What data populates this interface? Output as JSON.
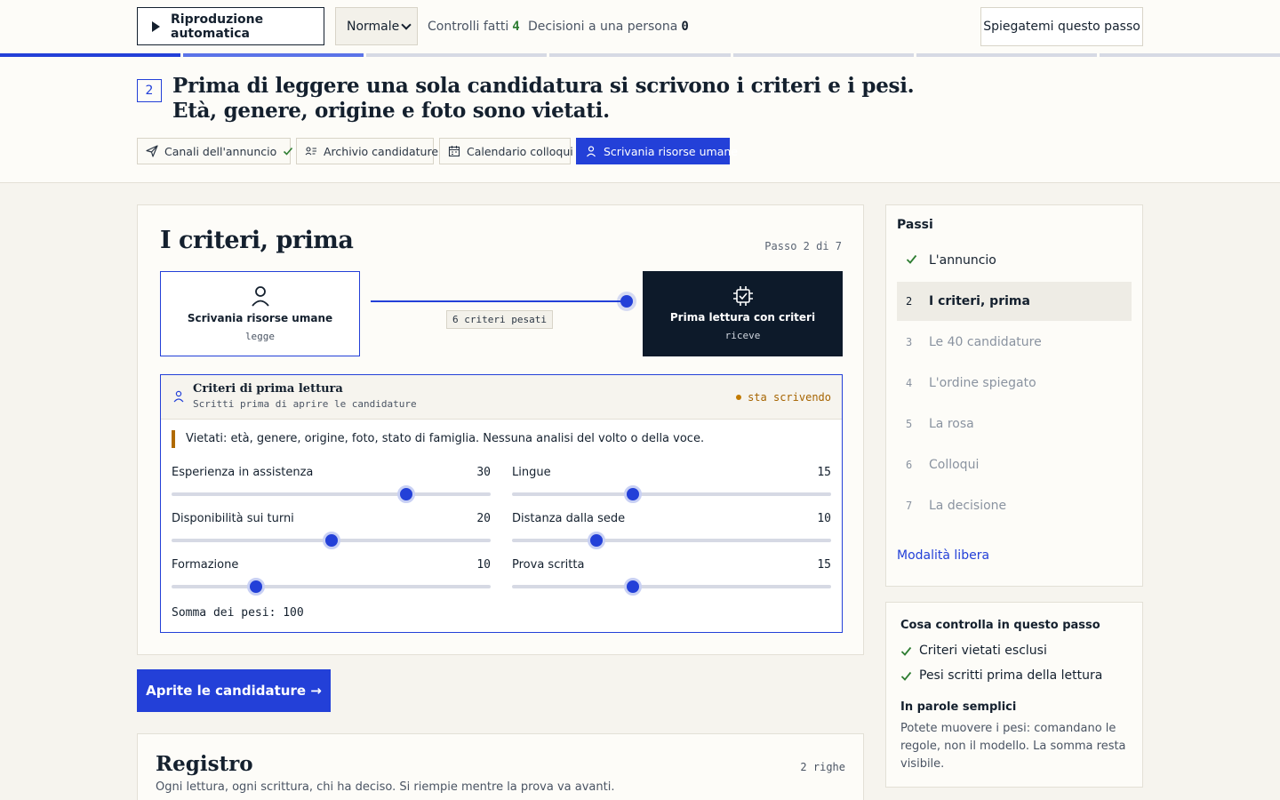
{
  "topbar": {
    "autoplay_label": "Riproduzione automatica",
    "speed_value": "Normale",
    "checks_label": "Controlli fatti",
    "checks_count": "4",
    "decisions_label": "Decisioni a una persona",
    "decisions_count": "0",
    "explain_label": "Spiegatemi questo passo"
  },
  "progress": {
    "segments": 7,
    "current": 2,
    "colors": {
      "done": "#2340d8",
      "current": "#5b73e8",
      "todo": "#d6d9e4"
    }
  },
  "step_header": {
    "number": "2",
    "line1": "Prima di leggere una sola candidatura si scrivono i criteri e i pesi.",
    "line2": "Età, genere, origine e foto sono vietati."
  },
  "chips": [
    {
      "label": "Canali dell'annuncio",
      "icon": "send-icon",
      "done": true
    },
    {
      "label": "Archivio candidature",
      "icon": "list-user-icon",
      "done": false
    },
    {
      "label": "Calendario colloqui",
      "icon": "calendar-icon",
      "done": false
    },
    {
      "label": "Scrivania risorse umane",
      "icon": "person-icon",
      "active": true
    }
  ],
  "main": {
    "title": "I criteri, prima",
    "step_indicator": "Passo 2 di 7",
    "actor_left": {
      "name": "Scrivania risorse umane",
      "role": "legge",
      "icon": "person-icon"
    },
    "actor_right": {
      "name": "Prima lettura con criteri",
      "role": "riceve",
      "icon": "chip-check-icon"
    },
    "connector_label": "6 criteri pesati",
    "criteria": {
      "title": "Criteri di prima lettura",
      "subtitle": "Scritti prima di aprire le candidature",
      "status": "sta scrivendo",
      "forbidden": "Vietati: età, genere, origine, foto, stato di famiglia. Nessuna analisi del volto o della voce.",
      "weights": [
        {
          "label": "Esperienza in assistenza",
          "value": "30",
          "fraction": 0.735
        },
        {
          "label": "Lingue",
          "value": "15",
          "fraction": 0.38
        },
        {
          "label": "Disponibilità sui turni",
          "value": "20",
          "fraction": 0.5
        },
        {
          "label": "Distanza dalla sede",
          "value": "10",
          "fraction": 0.265
        },
        {
          "label": "Formazione",
          "value": "10",
          "fraction": 0.265
        },
        {
          "label": "Prova scritta",
          "value": "15",
          "fraction": 0.38
        }
      ],
      "sum_label": "Somma dei pesi: 100"
    },
    "open_button": "Aprite le candidature →"
  },
  "register": {
    "title": "Registro",
    "count": "2 righe",
    "subtitle": "Ogni lettura, ogni scrittura, chi ha deciso. Si riempie mentre la prova va avanti."
  },
  "sidebar": {
    "title": "Passi",
    "steps": [
      {
        "n": "",
        "label": "L'annuncio",
        "state": "done"
      },
      {
        "n": "2",
        "label": "I criteri, prima",
        "state": "current"
      },
      {
        "n": "3",
        "label": "Le 40 candidature",
        "state": "todo"
      },
      {
        "n": "4",
        "label": "L'ordine spiegato",
        "state": "todo"
      },
      {
        "n": "5",
        "label": "La rosa",
        "state": "todo"
      },
      {
        "n": "6",
        "label": "Colloqui",
        "state": "todo"
      },
      {
        "n": "7",
        "label": "La decisione",
        "state": "todo"
      }
    ],
    "free_mode": "Modalità libera"
  },
  "checkbox_panel": {
    "title": "Cosa controlla in questo passo",
    "items": [
      "Criteri vietati esclusi",
      "Pesi scritti prima della lettura"
    ],
    "plain_title": "In parole semplici",
    "plain_text": "Potete muovere i pesi: comandano le regole, non il modello. La somma resta visibile."
  }
}
